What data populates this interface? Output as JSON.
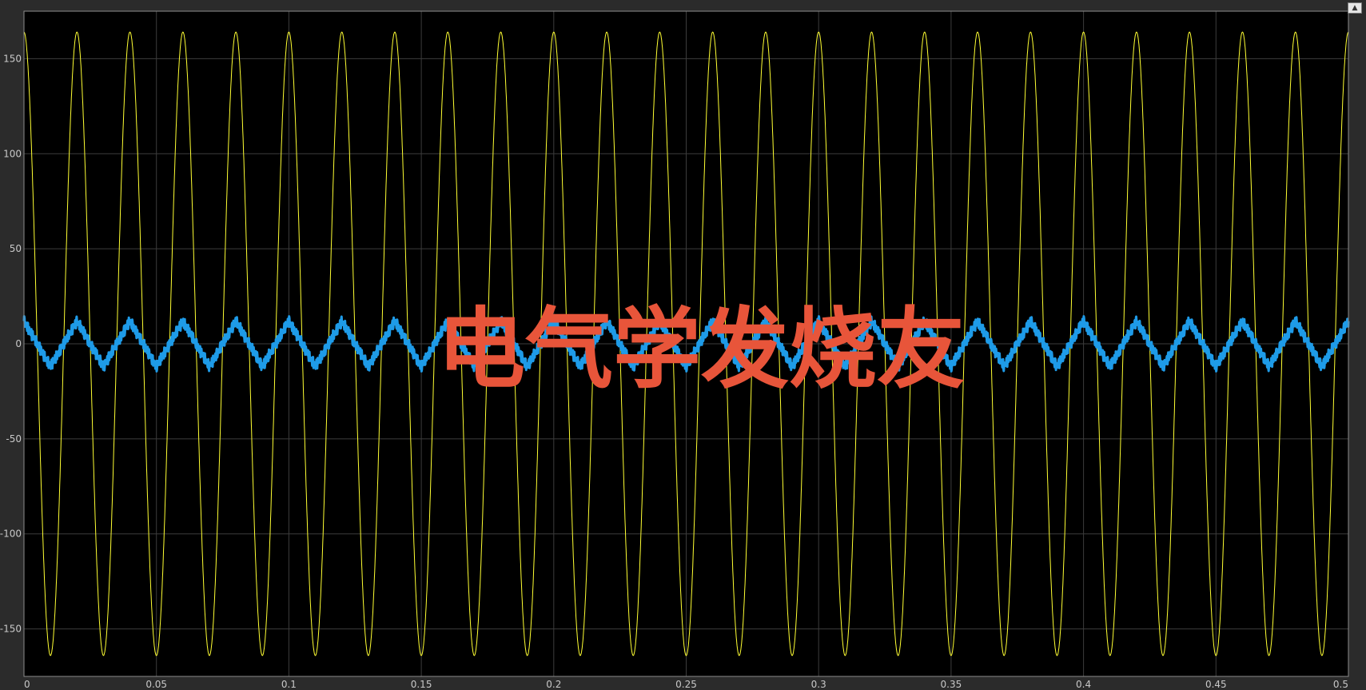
{
  "watermark": "电气学发烧友",
  "chart_data": {
    "type": "line",
    "xlim": [
      0,
      0.5
    ],
    "ylim": [
      -175,
      175
    ],
    "x_ticks": [
      0,
      0.05,
      0.1,
      0.15,
      0.2,
      0.25,
      0.3,
      0.35,
      0.4,
      0.45,
      0.5
    ],
    "x_tick_labels": [
      "0",
      "0.05",
      "0.1",
      "0.15",
      "0.2",
      "0.25",
      "0.3",
      "0.35",
      "0.4",
      "0.45",
      "0.5"
    ],
    "y_ticks": [
      150,
      100,
      50,
      0,
      -50,
      -100,
      -150
    ],
    "y_tick_labels": [
      "150",
      "100",
      "50",
      "0",
      "-50",
      "-100",
      "-150"
    ],
    "grid": true,
    "background": "#000000",
    "series": [
      {
        "color": "#ffff33",
        "waveform": "sine",
        "amplitude": 164,
        "frequency_hz": 50,
        "phase_deg": 90,
        "ripple": 0,
        "line_width": 1
      },
      {
        "color": "#1e9be8",
        "waveform": "triangle",
        "amplitude": 12,
        "frequency_hz": 50,
        "phase_deg": 90,
        "ripple": 3,
        "line_width": 3
      }
    ]
  }
}
